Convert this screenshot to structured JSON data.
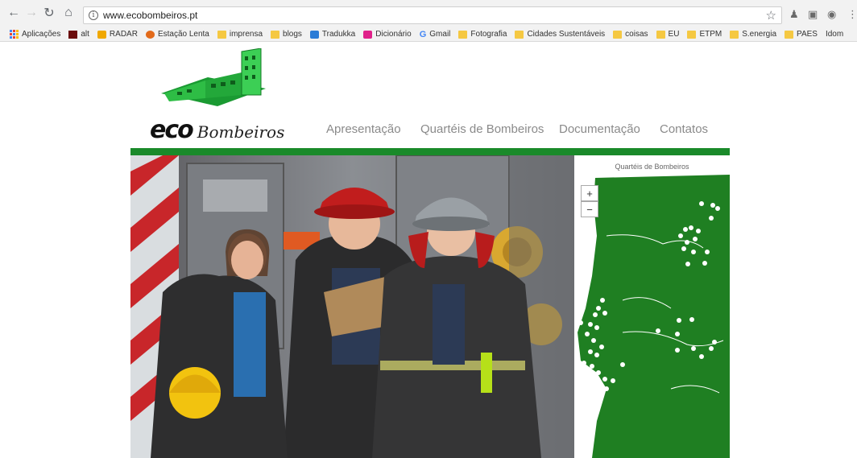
{
  "browser": {
    "url": "www.ecobombeiros.pt",
    "bookmarks": [
      {
        "label": "Aplicações",
        "icon": "apps-icon"
      },
      {
        "label": "alt",
        "icon": "alt-site-icon"
      },
      {
        "label": "RADAR",
        "icon": "radar-icon"
      },
      {
        "label": "Estação Lenta",
        "icon": "estacao-lenta-icon"
      },
      {
        "label": "imprensa",
        "icon": "folder-icon"
      },
      {
        "label": "blogs",
        "icon": "folder-icon"
      },
      {
        "label": "Tradukka",
        "icon": "tradukka-icon"
      },
      {
        "label": "Dicionário",
        "icon": "dicionario-icon"
      },
      {
        "label": "Gmail",
        "icon": "google-icon"
      },
      {
        "label": "Fotografia",
        "icon": "folder-icon"
      },
      {
        "label": "Cidades Sustentáveis",
        "icon": "folder-icon"
      },
      {
        "label": "coisas",
        "icon": "folder-icon"
      },
      {
        "label": "EU",
        "icon": "folder-icon"
      },
      {
        "label": "ETPM",
        "icon": "folder-icon"
      },
      {
        "label": "S.energia",
        "icon": "folder-icon"
      },
      {
        "label": "PAES",
        "icon": "folder-icon"
      },
      {
        "label": "Idom",
        "icon": "none"
      }
    ]
  },
  "site": {
    "logo_eco": "eco",
    "logo_bombeiros": "Bombeiros",
    "nav": [
      "Apresentação",
      "Quartéis de Bombeiros",
      "Documentação",
      "Contatos"
    ]
  },
  "map": {
    "title": "Quartéis de Bombeiros",
    "zoom_in": "+",
    "zoom_out": "−"
  },
  "colors": {
    "brand_green": "#1a8a2a",
    "map_green": "#1f7f22"
  }
}
